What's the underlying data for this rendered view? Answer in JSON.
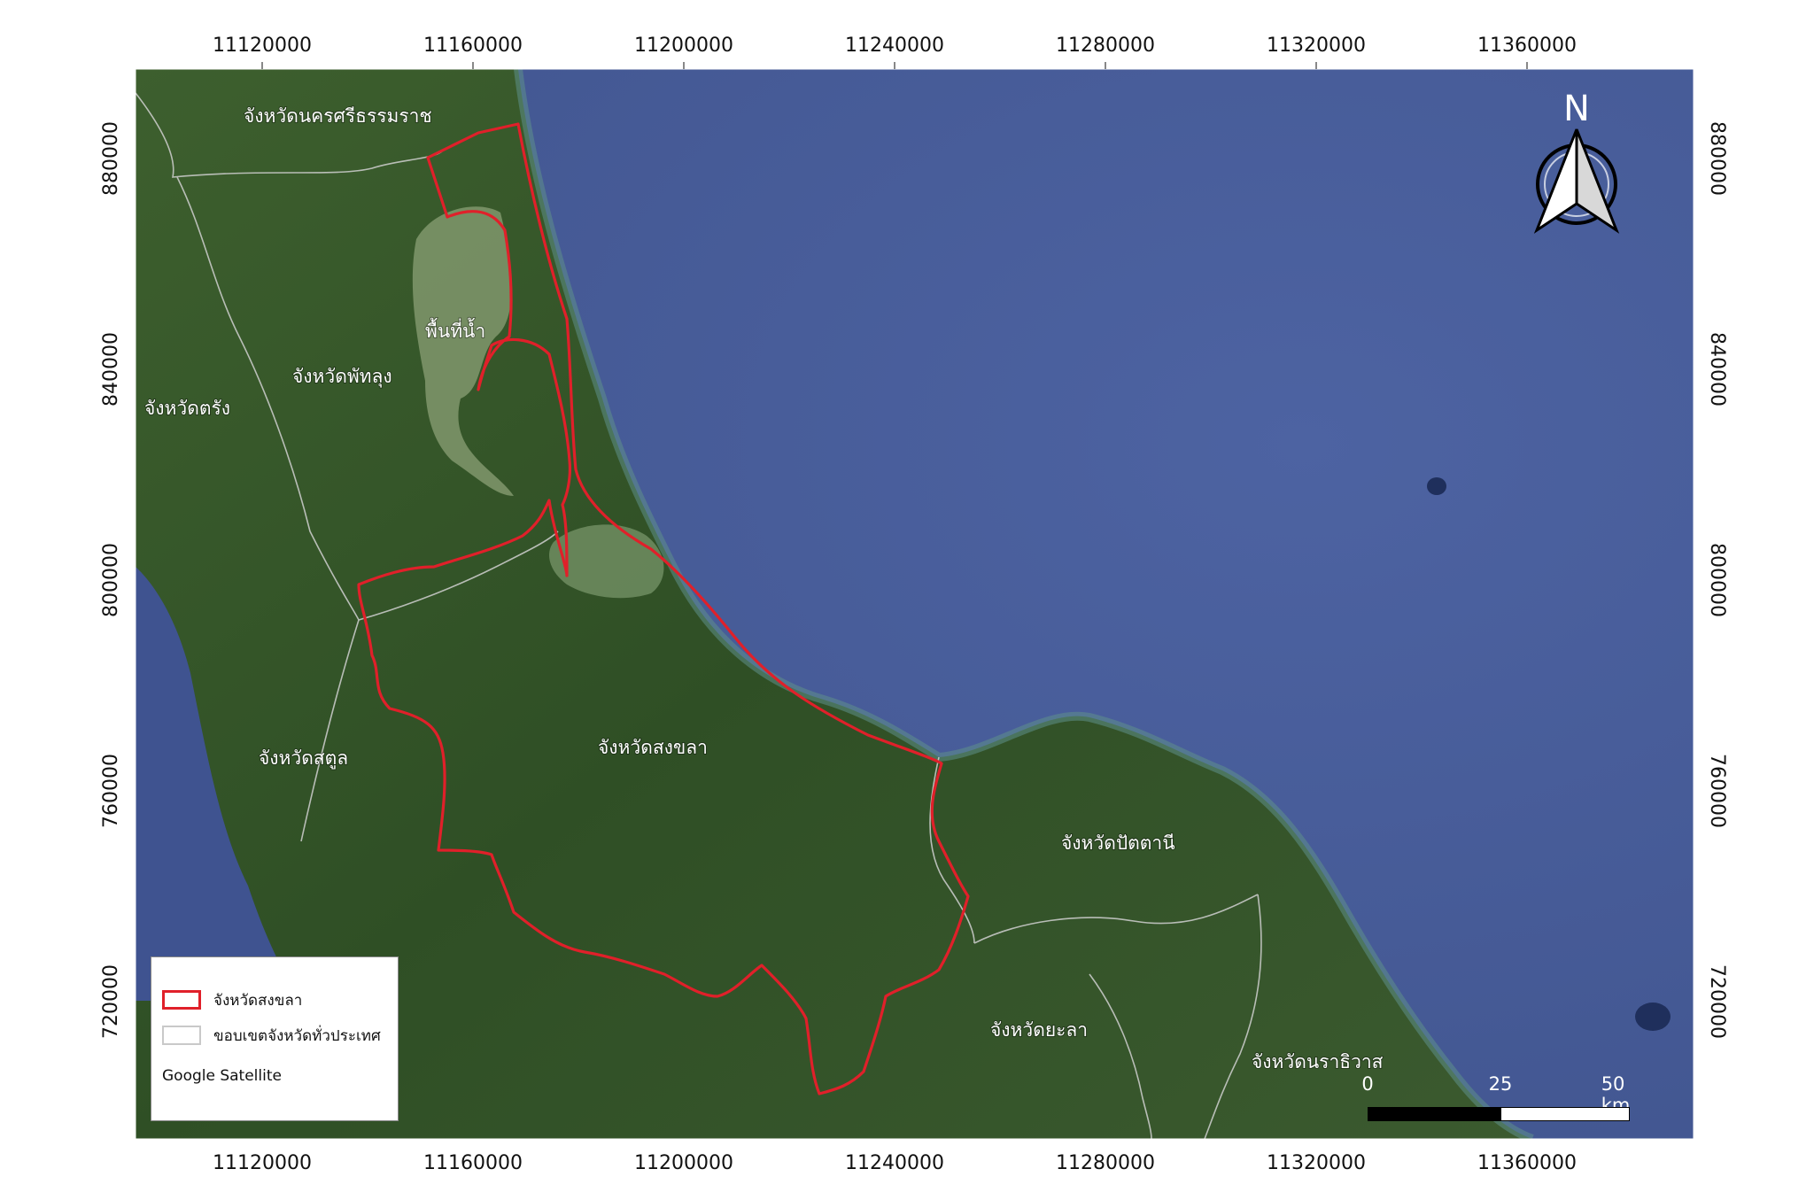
{
  "map": {
    "x_ticks": [
      "11120000",
      "11160000",
      "11200000",
      "11240000",
      "11280000",
      "11320000",
      "11360000"
    ],
    "y_ticks": [
      "880000",
      "840000",
      "800000",
      "760000",
      "720000"
    ],
    "place_labels": [
      "จังหวัดนครศรีธรรมราช",
      "พื้นที่น้ำ",
      "จังหวัดพัทลุง",
      "จังหวัดตรัง",
      "จังหวัดสงขลา",
      "จังหวัดสตูล",
      "จังหวัดปัตตานี",
      "จังหวัดยะลา",
      "จังหวัดนราธิวาส"
    ],
    "colors": {
      "sea": "#4a5e9c",
      "land": "#3a5b2c",
      "boundary_study": "#e0202a",
      "boundary_provinces": "#d0d0d0"
    }
  },
  "legend": {
    "study_area": "จังหวัดสงขลา",
    "provinces": "ขอบเขตจังหวัดทั่วประเทศ",
    "source": "Google Satellite"
  },
  "scale": {
    "labels": [
      "0",
      "25",
      "50 km"
    ]
  },
  "north_arrow": {
    "letter": "N",
    "icon": "north-arrow-icon"
  }
}
